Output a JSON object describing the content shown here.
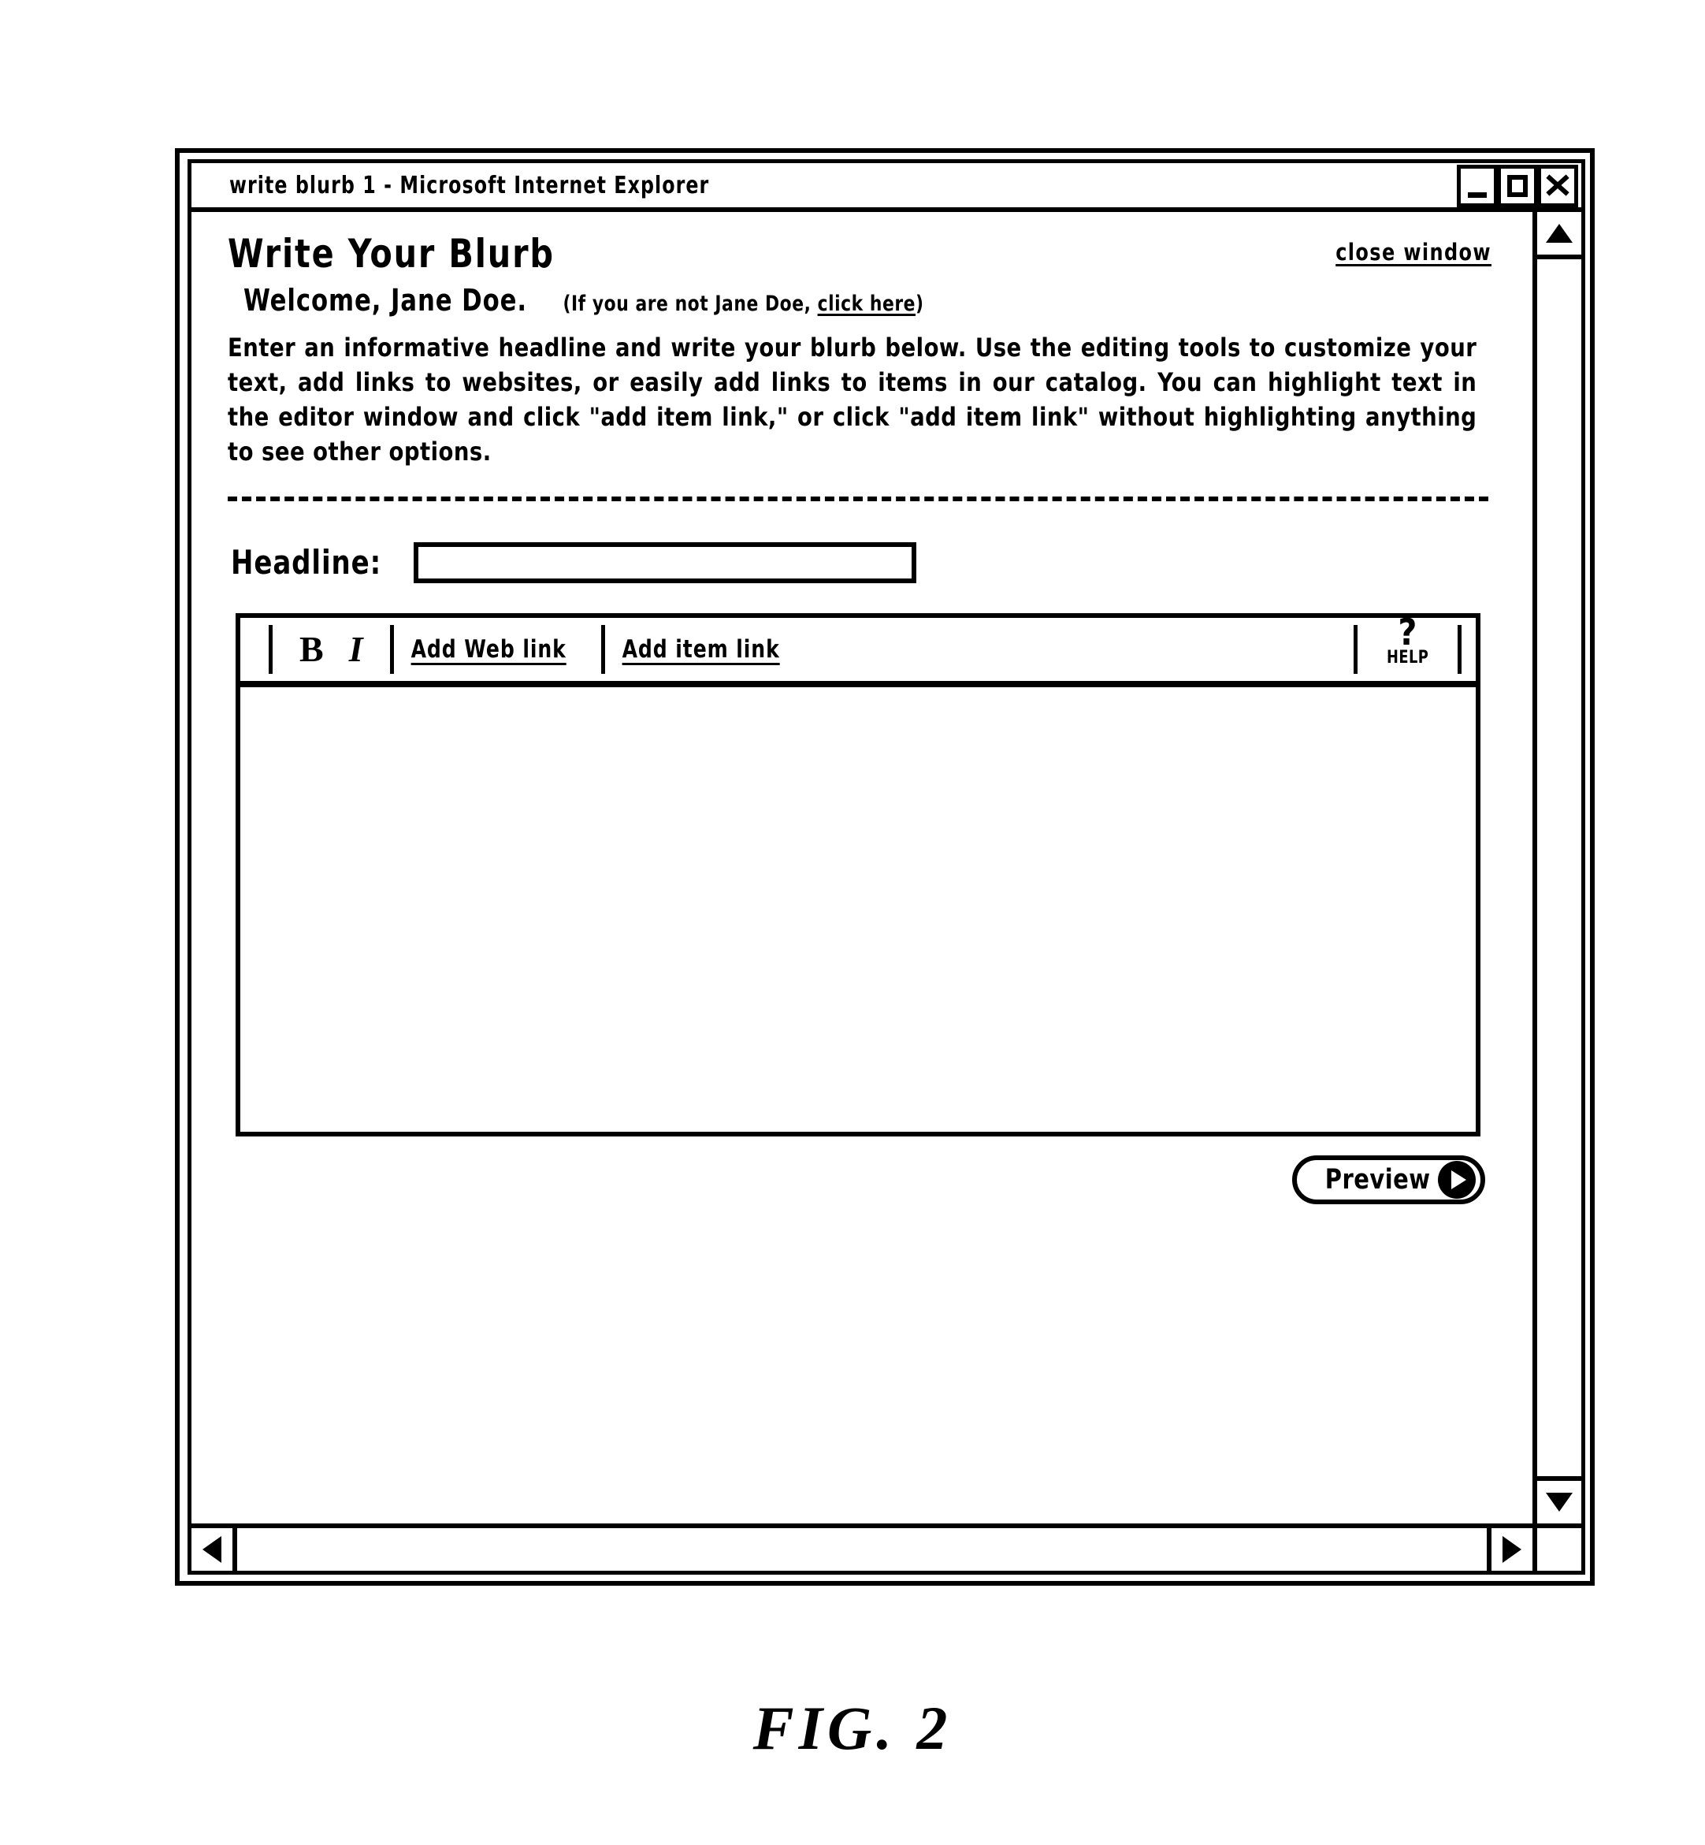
{
  "window": {
    "title": "write blurb 1 - Microsoft Internet Explorer",
    "controls": {
      "minimize_label": "Minimize",
      "maximize_label": "Maximize",
      "close_label": "Close"
    }
  },
  "page": {
    "title": "Write Your Blurb",
    "close_window_link": "close window",
    "welcome_strong": "Welcome, Jane Doe.",
    "welcome_note_prefix": "(If you are not Jane Doe, ",
    "welcome_note_link": "click here",
    "welcome_note_suffix": ")",
    "intro_paragraph": "Enter an informative headline and write your blurb below. Use the editing tools to customize your text, add links to websites, or easily add links to items in our catalog. You can highlight text in the editor window and click \"add item link,\" or click \"add item link\" without highlighting anything to see other options."
  },
  "form": {
    "headline_label": "Headline:",
    "headline_value": "",
    "headline_placeholder": ""
  },
  "editor": {
    "toolbar": {
      "bold_label": "B",
      "italic_label": "I",
      "add_web_link_label": "Add Web link",
      "add_item_link_label": "Add item link",
      "help_glyph": "?",
      "help_label": "HELP"
    },
    "body_value": "",
    "preview_button_label": "Preview"
  },
  "scrollbars": {
    "vertical_up": "▲",
    "vertical_down": "▼",
    "horizontal_left": "◀",
    "horizontal_right": "▶"
  },
  "figure": {
    "caption": "FIG. 2"
  }
}
